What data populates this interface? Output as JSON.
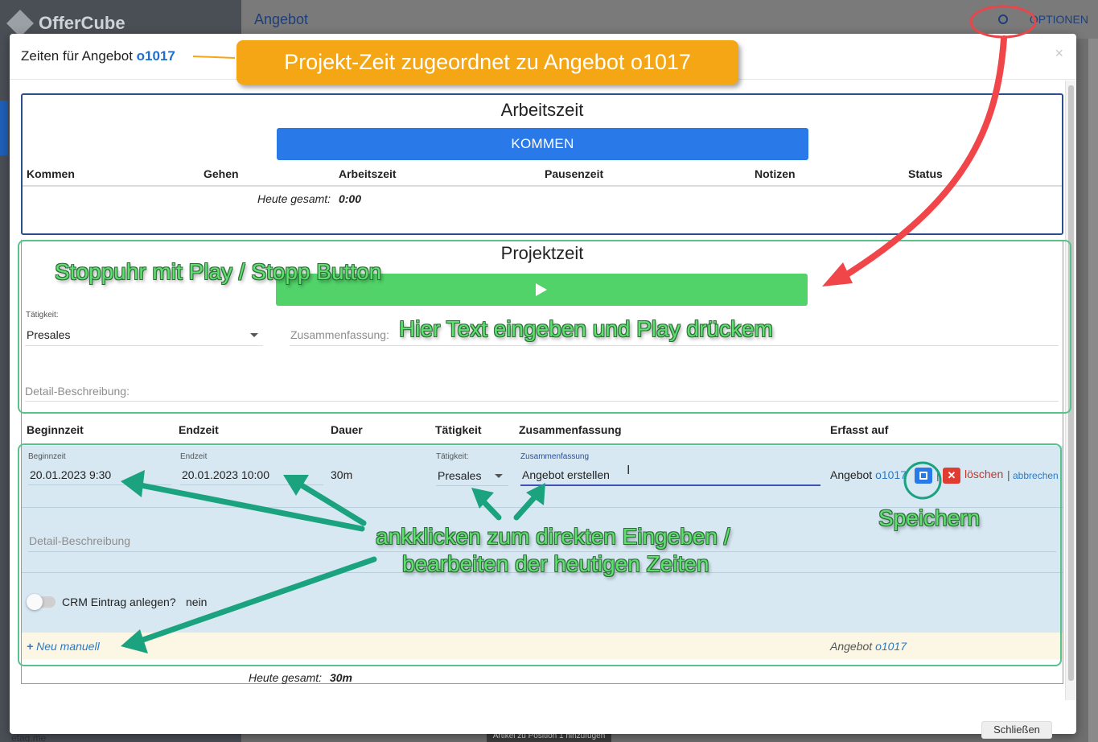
{
  "app": {
    "logo": "OfferCube",
    "breadcrumb": "Angebot",
    "options": "OPTIONEN",
    "bottom_left": "etag.me",
    "bottom_toast": "Artikel zu Position 1 hinzufügen"
  },
  "modal": {
    "title_prefix": "Zeiten für Angebot",
    "title_link": "o1017",
    "close": "×",
    "footer_button": "Schließen"
  },
  "arbeitszeit": {
    "title": "Arbeitszeit",
    "kommen_button": "KOMMEN",
    "columns": [
      "Kommen",
      "Gehen",
      "Arbeitszeit",
      "Pausenzeit",
      "Notizen",
      "Status"
    ],
    "total_label": "Heute gesamt:",
    "total_value": "0:00"
  },
  "projektzeit": {
    "title": "Projektzeit",
    "taetigkeit_label": "Tätigkeit:",
    "taetigkeit_value": "Presales",
    "zusammenfassung_placeholder": "Zusammenfassung:",
    "detail_placeholder": "Detail-Beschreibung:"
  },
  "table": {
    "columns": [
      "Beginnzeit",
      "Endzeit",
      "Dauer",
      "Tätigkeit",
      "Zusammenfassung",
      "Erfasst auf"
    ],
    "row": {
      "beginn_label": "Beginnzeit",
      "beginn": "20.01.2023 9:30",
      "ende_label": "Endzeit",
      "ende": "20.01.2023 10:00",
      "dauer": "30m",
      "taetigkeit_label": "Tätigkeit:",
      "taetigkeit": "Presales",
      "zusammenfassung_label": "Zusammenfassung",
      "zusammenfassung": "Angebot erstellen",
      "erfasst_prefix": "Angebot",
      "erfasst_link": "o1017",
      "delete": "löschen",
      "separator": "|",
      "cancel": "abbrechen",
      "detail_placeholder": "Detail-Beschreibung",
      "crm_label": "CRM Eintrag anlegen?",
      "crm_value": "nein"
    },
    "new_manual": "Neu manuell",
    "new_row_prefix": "Angebot",
    "new_row_link": "o1017",
    "total_label": "Heute gesamt:",
    "total_value": "30m"
  },
  "annotations": {
    "callout": "Projekt-Zeit zugeordnet zu Angebot o1017",
    "stopwatch": "Stoppuhr mit Play / Stopp Button",
    "enter_text": "Hier Text eingeben und Play drückem",
    "click_edit_line1": "ankklicken zum direkten Eingeben /",
    "click_edit_line2": "bearbeiten der heutigen Zeiten",
    "save": "Speichern"
  },
  "colors": {
    "primary": "#2a79e8",
    "play_green": "#52d36a",
    "callout_orange": "#f5a614",
    "annotation_green": "#5ee06e",
    "arrow_red": "#f0464a",
    "arrow_teal": "#1aa37e"
  }
}
